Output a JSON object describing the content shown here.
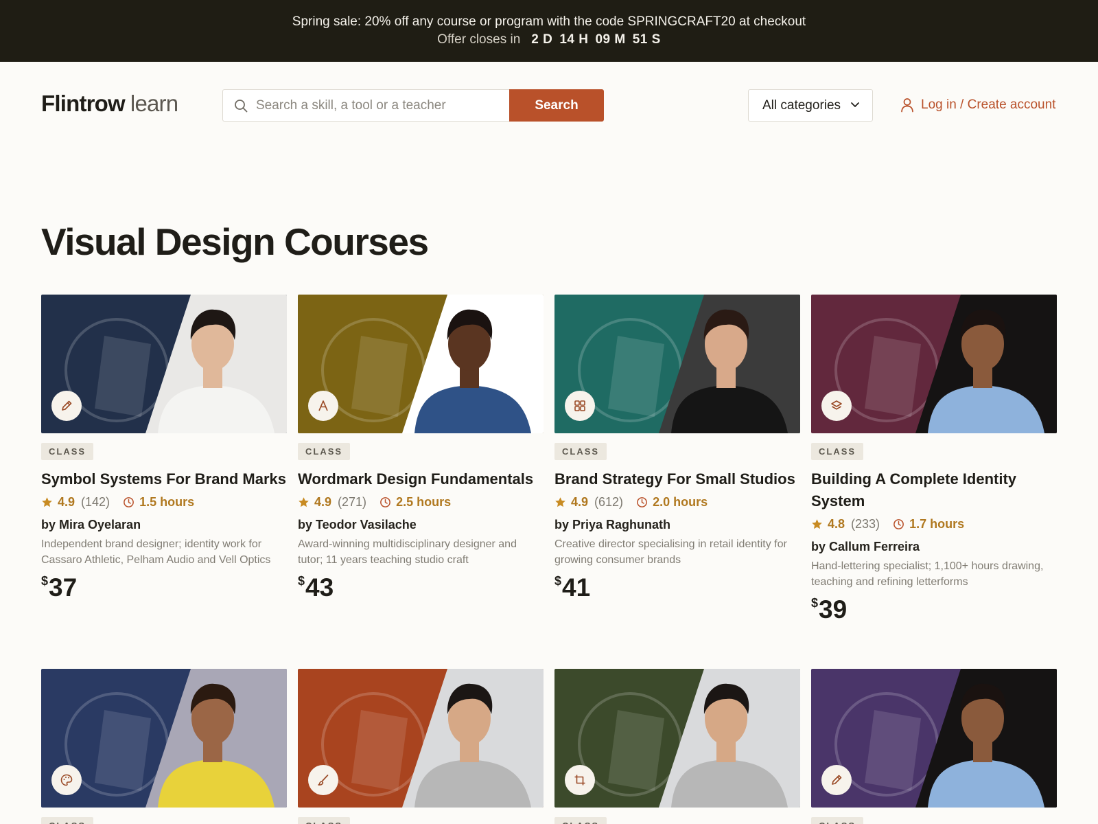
{
  "promo": {
    "message": "Spring sale: 20% off any course or program with the code SPRINGCRAFT20 at checkout",
    "countdown_label": "Offer closes in",
    "countdown": [
      "2 D",
      "14 H",
      "09 M",
      "51 S"
    ]
  },
  "header": {
    "logo_bold": "Flintrow",
    "logo_light": "learn",
    "search_placeholder": "Search a skill, a tool or a teacher",
    "search_button": "Search",
    "category_select": "All categories",
    "login_label": "Log in / Create account"
  },
  "page_title": "Visual Design Courses",
  "colors": {
    "accent": "#b9512a",
    "rating": "#b0781f",
    "promo_bg": "#1f1d14"
  },
  "courses": [
    {
      "tag": "CLASS",
      "title": "Symbol Systems For Brand Marks",
      "rating": "4.9",
      "count": "(142)",
      "hours": "1.5 hours",
      "author": "by Mira Oyelaran",
      "bio": "Independent brand designer; identity work for Cassaro Athletic, Pelham Audio and Vell Optics",
      "currency": "$",
      "price": "37",
      "icon": "pencil-icon",
      "color": "#22304a"
    },
    {
      "tag": "CLASS",
      "title": "Wordmark Design Fundamentals",
      "rating": "4.9",
      "count": "(271)",
      "hours": "2.5 hours",
      "author": "by Teodor Vasilache",
      "bio": "Award-winning multidisciplinary designer and tutor; 11 years teaching studio craft",
      "currency": "$",
      "price": "43",
      "icon": "type-a-icon",
      "color": "#7c6414"
    },
    {
      "tag": "CLASS",
      "title": "Brand Strategy For Small Studios",
      "rating": "4.9",
      "count": "(612)",
      "hours": "2.0 hours",
      "author": "by Priya Raghunath",
      "bio": "Creative director specialising in retail identity for growing consumer brands",
      "currency": "$",
      "price": "41",
      "icon": "grid-icon",
      "color": "#1f6b63"
    },
    {
      "tag": "CLASS",
      "title": "Building A Complete Identity System",
      "rating": "4.8",
      "count": "(233)",
      "hours": "1.7 hours",
      "author": "by Callum Ferreira",
      "bio": "Hand-lettering specialist; 1,100+ hours drawing, teaching and refining letterforms",
      "currency": "$",
      "price": "39",
      "icon": "layers-icon",
      "color": "#62283d"
    },
    {
      "tag": "CLASS",
      "icon": "palette-icon",
      "color": "#2a3a63"
    },
    {
      "tag": "CLASS",
      "icon": "brush-icon",
      "color": "#a9441f"
    },
    {
      "tag": "CLASS",
      "icon": "crop-icon",
      "color": "#3c4a2b"
    },
    {
      "tag": "CLASS",
      "icon": "pencil-icon",
      "color": "#4a3569"
    }
  ]
}
